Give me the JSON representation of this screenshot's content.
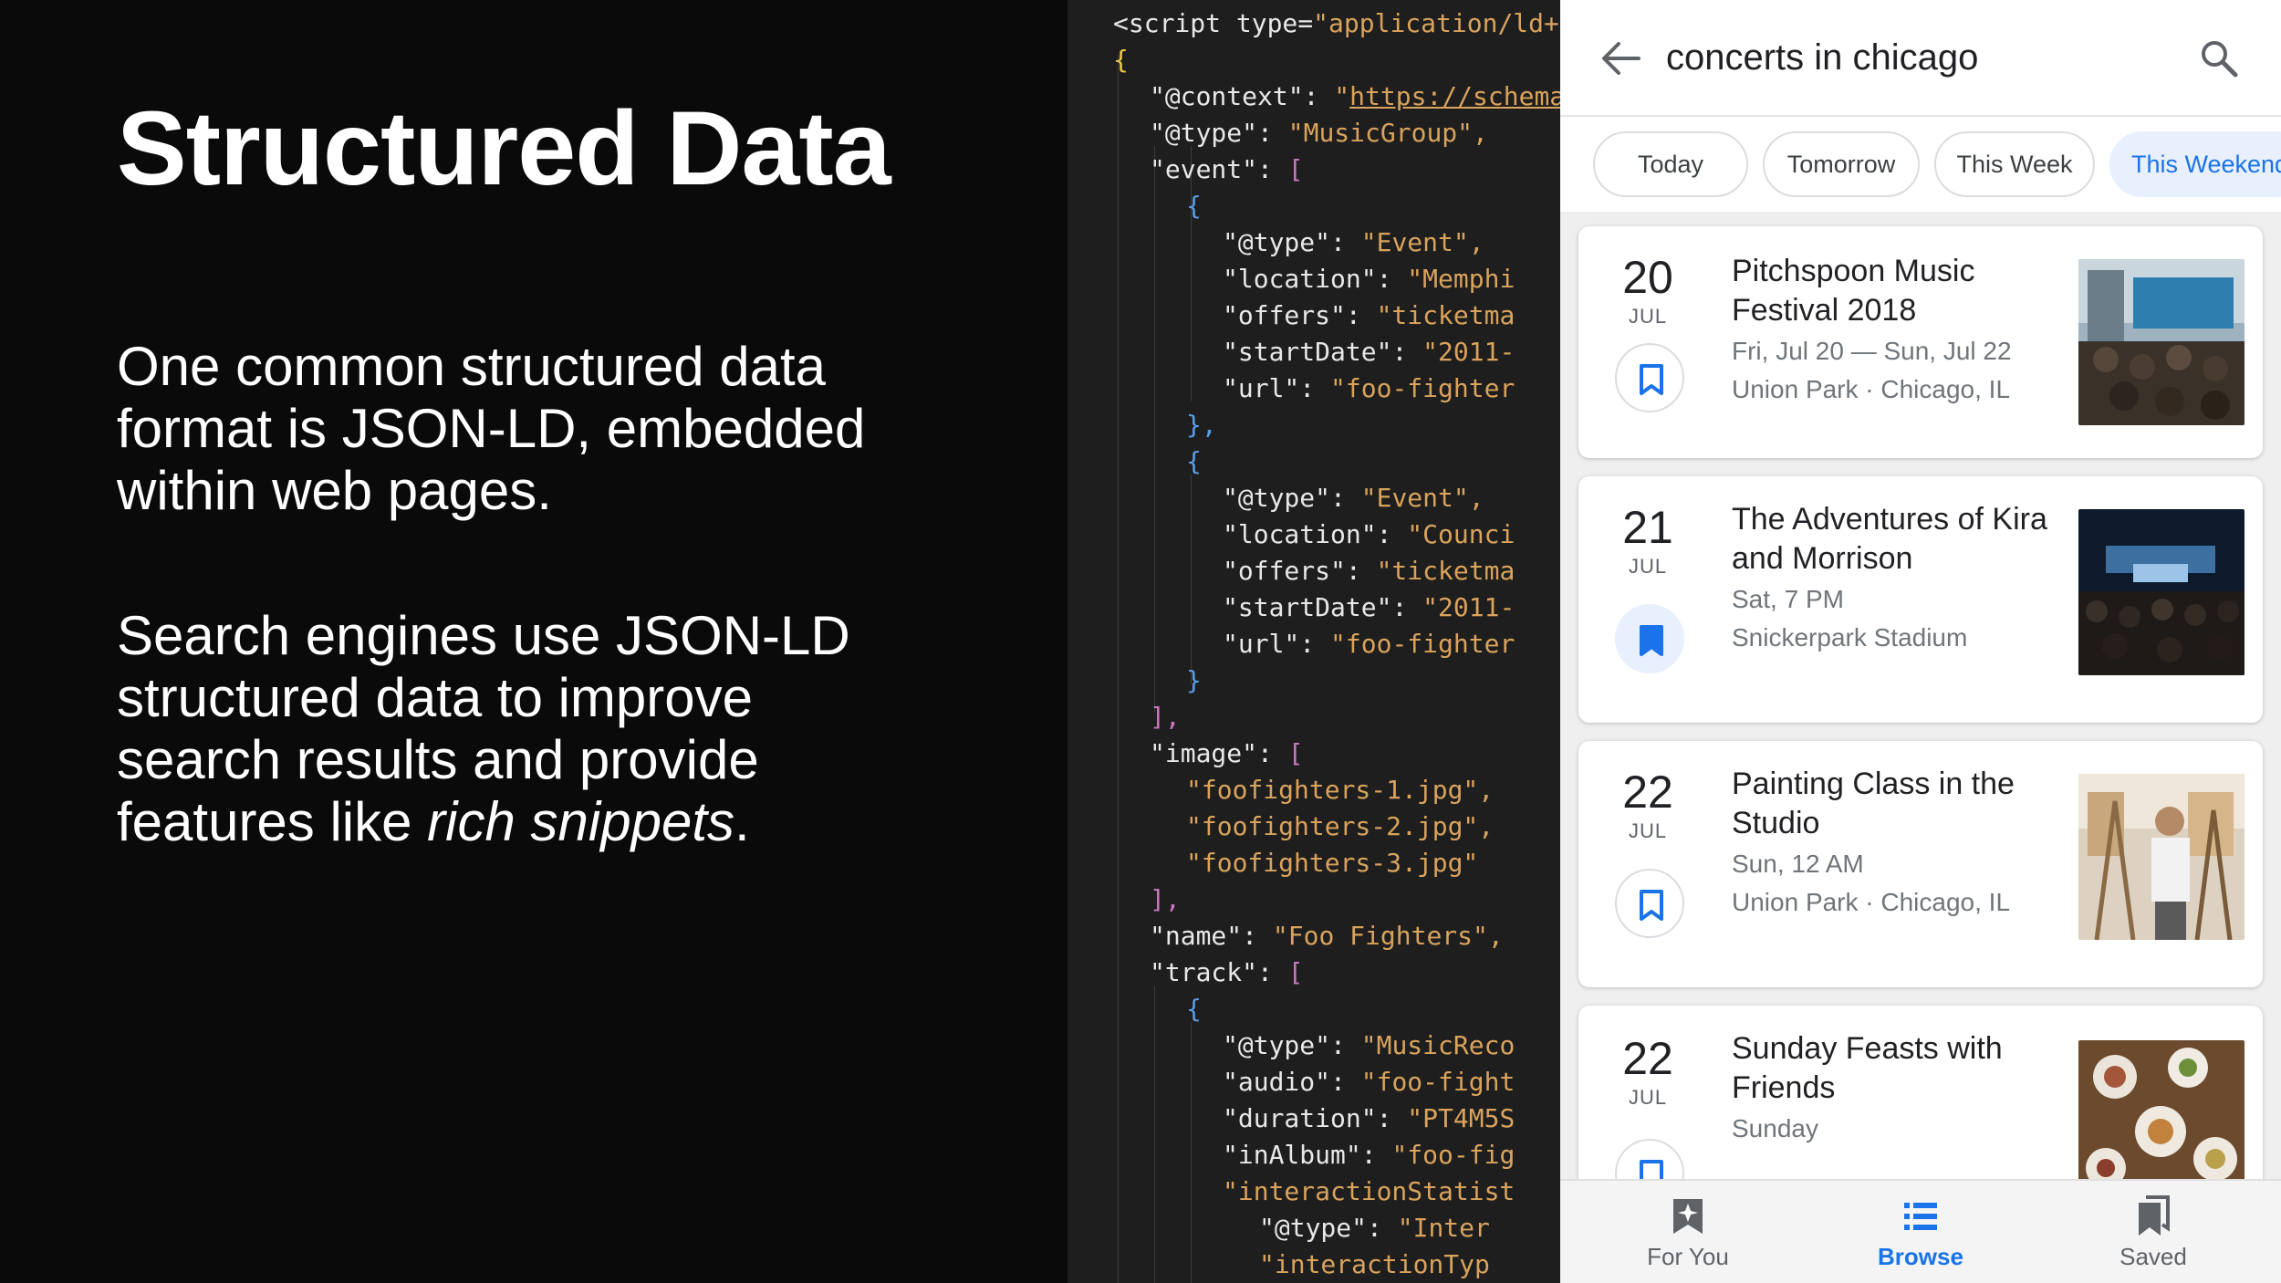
{
  "slide": {
    "title": "Structured Data",
    "para1": "One common structured data format is JSON-LD, embedded within web pages.",
    "para2_before": "Search engines use JSON-LD structured data to improve search results and provide features like ",
    "para2_em": "rich snippets",
    "para2_after": "."
  },
  "code": {
    "lines": [
      "<script type=\"application/ld+js",
      "{",
      "\"@context\": \"https://schema",
      "\"@type\": \"MusicGroup\",",
      "\"event\": [",
      "{",
      "\"@type\": \"Event\",",
      "\"location\": \"Memphi",
      "\"offers\": \"ticketma",
      "\"startDate\": \"2011-",
      "\"url\": \"foo-fighter",
      "},",
      "{",
      "\"@type\": \"Event\",",
      "\"location\": \"Counci",
      "\"offers\": \"ticketma",
      "\"startDate\": \"2011-",
      "\"url\": \"foo-fighter",
      "}",
      "],",
      "\"image\": [",
      "\"foofighters-1.jpg\",",
      "\"foofighters-2.jpg\",",
      "\"foofighters-3.jpg\"",
      "],",
      "\"name\": \"Foo Fighters\",",
      "\"track\": [",
      "{",
      "\"@type\": \"MusicReco",
      "\"audio\": \"foo-fight",
      "\"duration\": \"PT4M5S",
      "\"inAlbum\": \"foo-fig",
      "\"interactionStatist",
      "\"@type\": \"Inter",
      "\"interactionTyp"
    ]
  },
  "phone": {
    "search": {
      "query": "concerts in chicago"
    },
    "chips": [
      "Today",
      "Tomorrow",
      "This Week",
      "This Weekend"
    ],
    "events": [
      {
        "day": "20",
        "month": "JUL",
        "title": "Pitchspoon Music Festival 2018",
        "date": "Fri, Jul 20 — Sun, Jul 22",
        "place": "Union Park · Chicago, IL",
        "saved": false
      },
      {
        "day": "21",
        "month": "JUL",
        "title": "The Adventures of Kira and Morrison",
        "date": "Sat, 7 PM",
        "place": "Snickerpark Stadium",
        "saved": true
      },
      {
        "day": "22",
        "month": "JUL",
        "title": "Painting Class in the Studio",
        "date": "Sun, 12 AM",
        "place": "Union Park · Chicago, IL",
        "saved": false
      },
      {
        "day": "22",
        "month": "JUL",
        "title": "Sunday Feasts with Friends",
        "date": "Sunday",
        "place": "",
        "saved": false
      }
    ],
    "nav": [
      "For You",
      "Browse",
      "Saved"
    ],
    "colors": {
      "accent": "#1a73e8",
      "chip_active_bg": "#e8f0fe"
    },
    "icons": {
      "back": "arrow-left-icon",
      "search": "magnifier-icon",
      "bookmark": "bookmark-icon",
      "for_you": "sparkle-card-icon",
      "browse": "list-icon",
      "saved": "bookmarks-icon"
    }
  }
}
